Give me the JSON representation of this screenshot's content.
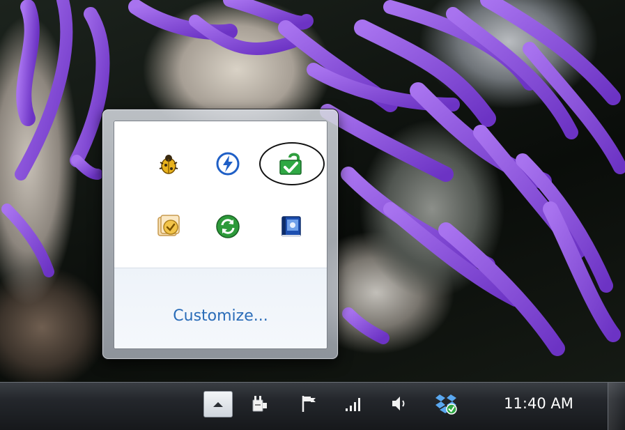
{
  "flyout": {
    "icons": [
      {
        "name": "bug-icon"
      },
      {
        "name": "lightning-icon"
      },
      {
        "name": "green-check-sync-icon"
      },
      {
        "name": "calendar-check-icon"
      },
      {
        "name": "green-refresh-icon"
      },
      {
        "name": "blue-book-icon"
      }
    ],
    "customize_label": "Customize..."
  },
  "taskbar": {
    "clock_text": "11:40 AM",
    "tray": [
      {
        "name": "show-hidden-icons"
      },
      {
        "name": "power-plug-icon"
      },
      {
        "name": "action-center-flag-icon"
      },
      {
        "name": "network-signal-icon"
      },
      {
        "name": "volume-icon"
      },
      {
        "name": "dropbox-icon"
      }
    ]
  },
  "colors": {
    "link_blue": "#2a6cb8",
    "wallpaper_purple": "#8a4fd9",
    "taskbar_dark": "#16181b"
  }
}
